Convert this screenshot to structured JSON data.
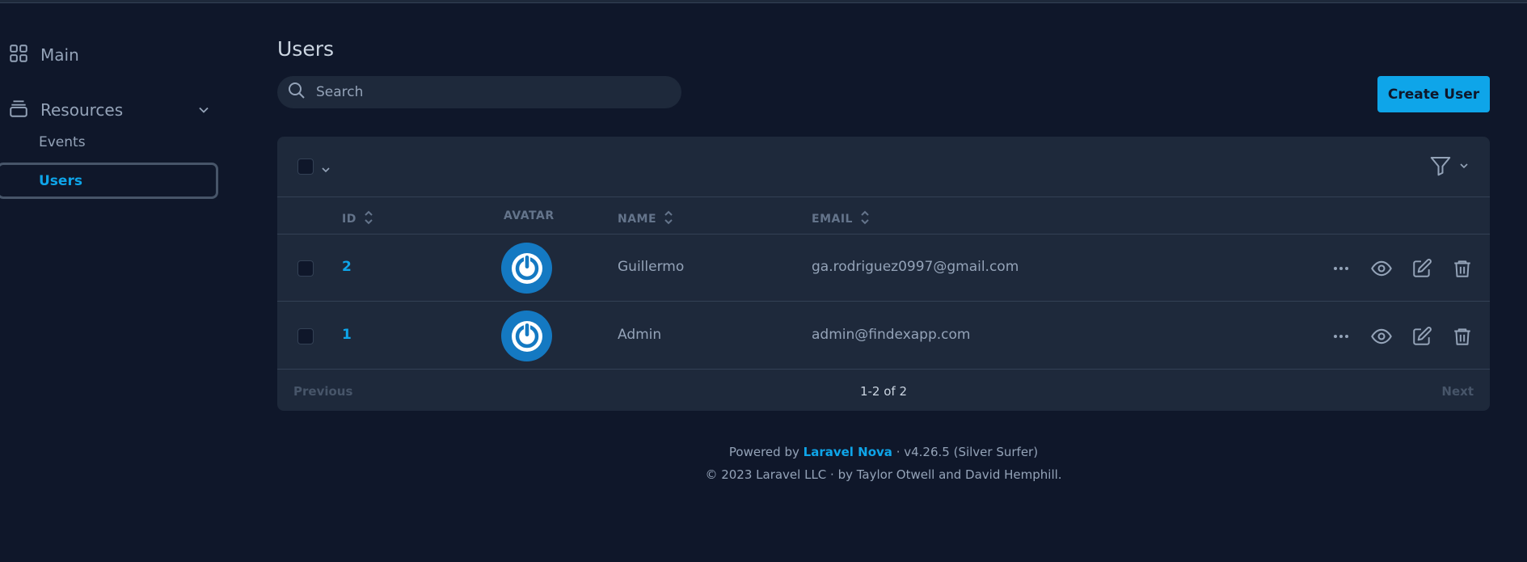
{
  "sidebar": {
    "main_label": "Main",
    "resources_label": "Resources",
    "items": [
      {
        "label": "Events"
      },
      {
        "label": "Users"
      }
    ]
  },
  "page": {
    "title": "Users"
  },
  "search": {
    "placeholder": "Search"
  },
  "toolbar": {
    "create_label": "Create User"
  },
  "table": {
    "columns": [
      "ID",
      "AVATAR",
      "NAME",
      "EMAIL"
    ],
    "rows": [
      {
        "id": "2",
        "name": "Guillermo",
        "email": "ga.rodriguez0997@gmail.com"
      },
      {
        "id": "1",
        "name": "Admin",
        "email": "admin@findexapp.com"
      }
    ]
  },
  "pagination": {
    "previous": "Previous",
    "count": "1-2 of 2",
    "next": "Next"
  },
  "footer": {
    "powered_by": "Powered by",
    "product": "Laravel Nova",
    "version": "· v4.26.5 (Silver Surfer)",
    "copyright": "© 2023 Laravel LLC · by Taylor Otwell and David Hemphill."
  },
  "colors": {
    "background": "#0f172a",
    "panel": "#1e293b",
    "accent": "#0ea5e9",
    "avatar": "#1479c2"
  }
}
